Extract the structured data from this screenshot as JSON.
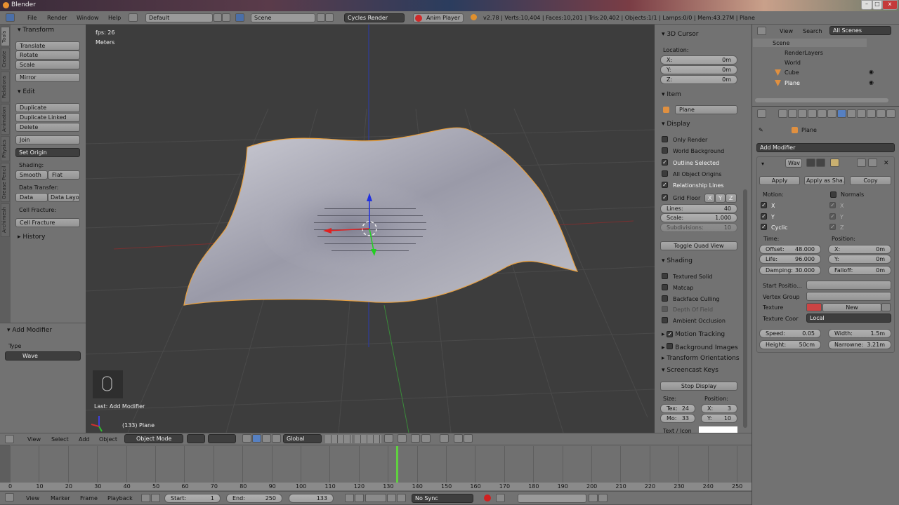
{
  "window": {
    "title": "Blender",
    "min": "–",
    "max": "□",
    "close": "x"
  },
  "info_header": {
    "menus": [
      "File",
      "Render",
      "Window",
      "Help"
    ],
    "layout": "Default",
    "scene": "Scene",
    "engine": "Cycles Render",
    "anim_player": "Anim Player",
    "stats": "v2.78 | Verts:10,404 | Faces:10,201 | Tris:20,402 | Objects:1/1 | Lamps:0/0 | Mem:43.27M | Plane"
  },
  "tool_tabs": [
    "Tools",
    "Create",
    "Relations",
    "Animation",
    "Physics",
    "Grease Pencil",
    "Archimesh"
  ],
  "toolshelf": {
    "transform": {
      "title": "Transform",
      "buttons": [
        "Translate",
        "Rotate",
        "Scale",
        "Mirror"
      ]
    },
    "edit": {
      "title": "Edit",
      "buttons": [
        "Duplicate",
        "Duplicate Linked",
        "Delete",
        "Join"
      ],
      "set_origin": "Set Origin",
      "shading_label": "Shading:",
      "smooth": "Smooth",
      "flat": "Flat",
      "data_transfer_label": "Data Transfer:",
      "data": "Data",
      "data_layo": "Data Layo",
      "cell_fracture_label": "Cell Fracture:",
      "cell_fracture": "Cell Fracture"
    },
    "history": "History"
  },
  "operator_panel": {
    "title": "Add Modifier",
    "type_label": "Type",
    "type_value": "Wave"
  },
  "viewport": {
    "fps": "fps: 26",
    "units": "Meters",
    "last_op": "Last: Add Modifier",
    "object_info": "(133) Plane",
    "axis_y": "y"
  },
  "npanel": {
    "cursor": {
      "title": "3D Cursor",
      "location_label": "Location:",
      "x_label": "X:",
      "x": "0m",
      "y_label": "Y:",
      "y": "0m",
      "z_label": "Z:",
      "z": "0m"
    },
    "item": {
      "title": "Item",
      "name": "Plane"
    },
    "display": {
      "title": "Display",
      "options": [
        {
          "label": "Only Render",
          "checked": false
        },
        {
          "label": "World Background",
          "checked": false
        },
        {
          "label": "Outline Selected",
          "checked": true
        },
        {
          "label": "All Object Origins",
          "checked": false
        },
        {
          "label": "Relationship Lines",
          "checked": true
        }
      ],
      "grid_floor": "Grid Floor",
      "axes": [
        "X",
        "Y",
        "Z"
      ],
      "lines_label": "Lines:",
      "lines": "40",
      "scale_label": "Scale:",
      "scale": "1.000",
      "subdiv_label": "Subdivisions:",
      "subdiv": "10",
      "toggle_quad": "Toggle Quad View"
    },
    "shading": {
      "title": "Shading",
      "options": [
        {
          "label": "Textured Solid",
          "checked": false
        },
        {
          "label": "Matcap",
          "checked": false
        },
        {
          "label": "Backface Culling",
          "checked": false
        },
        {
          "label": "Depth Of Field",
          "checked": false
        },
        {
          "label": "Ambient Occlusion",
          "checked": false
        }
      ]
    },
    "collapsed": [
      "Motion Tracking",
      "Background Images",
      "Transform Orientations"
    ],
    "screencast": {
      "title": "Screencast Keys",
      "stop": "Stop Display",
      "size_label": "Size:",
      "position_label": "Position:",
      "tex_label": "Tex:",
      "tex": "24",
      "mo_label": "Mo:",
      "mo": "33",
      "x_label": "X:",
      "x": "3",
      "y_label": "Y:",
      "y": "10",
      "text_icon": "Text / Icon"
    }
  },
  "outliner": {
    "view": "View",
    "search": "Search",
    "filter": "All Scenes",
    "items": [
      "Scene",
      "RenderLayers",
      "World",
      "Cube",
      "Plane"
    ]
  },
  "properties": {
    "breadcrumb": "Plane",
    "add_modifier": "Add Modifier",
    "modifier_name": "Wav",
    "apply": "Apply",
    "apply_shape": "Apply as Sha...",
    "copy": "Copy",
    "motion_label": "Motion:",
    "normals": "Normals",
    "motion_x": "X",
    "motion_y": "Y",
    "cyclic": "Cyclic",
    "nx": "X",
    "ny": "Y",
    "nz": "Z",
    "time_label": "Time:",
    "position_label": "Position:",
    "offset_label": "Offset:",
    "offset": "48.000",
    "life_label": "Life:",
    "life": "96.000",
    "damping_label": "Damping:",
    "damping": "30.000",
    "px_label": "X:",
    "px": "0m",
    "py_label": "Y:",
    "py": "0m",
    "falloff_label": "Falloff:",
    "falloff": "0m",
    "start_pos": "Start Positio...",
    "vertex_group": "Vertex Group",
    "texture": "Texture",
    "texture_new": "New",
    "texture_coor": "Texture Coor",
    "texture_coor_value": "Local",
    "speed_label": "Speed:",
    "speed": "0.05",
    "width_label": "Width:",
    "width": "1.5m",
    "height_label": "Height:",
    "height": "50cm",
    "narrow_label": "Narrowne:",
    "narrow": "3.21m"
  },
  "view3d_header": {
    "menus": [
      "View",
      "Select",
      "Add",
      "Object"
    ],
    "mode": "Object Mode",
    "orientation": "Global"
  },
  "timeline": {
    "ticks": [
      0,
      10,
      20,
      30,
      40,
      50,
      60,
      70,
      80,
      90,
      100,
      110,
      120,
      130,
      140,
      150,
      160,
      170,
      180,
      190,
      200,
      210,
      220,
      230,
      240,
      250
    ],
    "current_frame": 133,
    "menus": [
      "View",
      "Marker",
      "Frame",
      "Playback"
    ],
    "start_label": "Start:",
    "start": "1",
    "end_label": "End:",
    "end": "250",
    "frame": "133",
    "sync": "No Sync"
  },
  "colors": {
    "viewport_bg": "#3d3d3d",
    "selection_outline": "#f0a040",
    "frame_line": "#60d040",
    "active_tab": "#5680c2"
  }
}
